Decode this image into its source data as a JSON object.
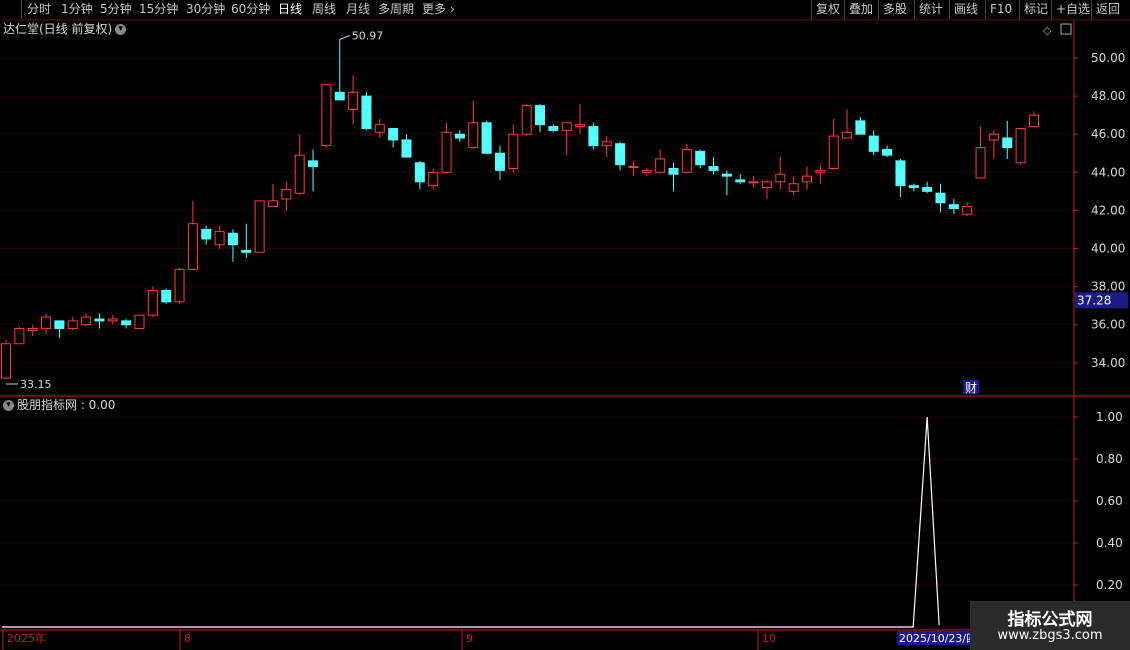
{
  "toolbar": {
    "periods": [
      "分时",
      "1分钟",
      "5分钟",
      "15分钟",
      "30分钟",
      "60分钟",
      "日线",
      "周线",
      "月线",
      "多周期",
      "更多"
    ],
    "active_period": "日线",
    "tools": [
      "复权",
      "叠加",
      "多股",
      "统计",
      "画线",
      "F10",
      "标记",
      "+自选",
      "返回"
    ]
  },
  "chart": {
    "title": "达仁堂(日线 前复权)",
    "max_label": "50.97",
    "min_label": "33.15",
    "current_price": "37.28",
    "finance_marker": "财",
    "up_color": "#ff3b3b",
    "down_color": "#54ffff",
    "axis_color": "#c02020"
  },
  "indicator": {
    "title": "股朋指标网 : 0.00",
    "line_color": "#ffffff"
  },
  "xaxis": {
    "labels": [
      "2025年",
      "8",
      "9",
      "10"
    ],
    "cursor_date": "2025/10/23/四"
  },
  "watermark": {
    "title": "指标公式网",
    "url": "www.zbgs3.com"
  },
  "chart_data": {
    "type": "candlestick",
    "price_axis_ticks": [
      34.0,
      36.0,
      38.0,
      40.0,
      42.0,
      44.0,
      46.0,
      48.0,
      50.0
    ],
    "price_ylim": [
      32.5,
      51.5
    ],
    "indicator_axis_ticks": [
      0.2,
      0.4,
      0.6,
      0.8,
      1.0
    ],
    "indicator_ylim": [
      0,
      1.1
    ],
    "candles": [
      [
        33.2,
        35.2,
        33.15,
        35.0
      ],
      [
        35.0,
        35.9,
        35.0,
        35.8
      ],
      [
        35.7,
        36.0,
        35.4,
        35.8
      ],
      [
        35.8,
        36.6,
        35.5,
        36.4
      ],
      [
        36.2,
        36.2,
        35.3,
        35.8
      ],
      [
        35.8,
        36.4,
        35.7,
        36.2
      ],
      [
        36.0,
        36.6,
        35.9,
        36.4
      ],
      [
        36.3,
        36.6,
        35.8,
        36.2
      ],
      [
        36.2,
        36.5,
        36.0,
        36.3
      ],
      [
        36.2,
        36.3,
        35.8,
        36.0
      ],
      [
        35.8,
        36.5,
        35.8,
        36.5
      ],
      [
        36.5,
        38.0,
        36.4,
        37.8
      ],
      [
        37.8,
        37.9,
        37.1,
        37.2
      ],
      [
        37.2,
        39.0,
        37.1,
        38.9
      ],
      [
        38.9,
        42.5,
        38.9,
        41.3
      ],
      [
        41.0,
        41.2,
        40.2,
        40.5
      ],
      [
        40.2,
        41.2,
        40.0,
        40.9
      ],
      [
        40.8,
        41.0,
        39.3,
        40.2
      ],
      [
        39.9,
        41.3,
        39.5,
        39.8
      ],
      [
        39.8,
        42.4,
        39.8,
        42.5
      ],
      [
        42.2,
        43.4,
        42.2,
        42.5
      ],
      [
        42.6,
        43.5,
        42.0,
        43.1
      ],
      [
        42.9,
        46.0,
        42.8,
        44.9
      ],
      [
        44.6,
        45.2,
        43.0,
        44.3
      ],
      [
        45.4,
        47.8,
        45.3,
        48.6
      ],
      [
        48.2,
        50.97,
        47.8,
        47.8
      ],
      [
        47.3,
        49.1,
        46.5,
        48.2
      ],
      [
        48.0,
        48.2,
        46.2,
        46.3
      ],
      [
        46.1,
        46.8,
        45.8,
        46.5
      ],
      [
        46.3,
        46.3,
        45.3,
        45.7
      ],
      [
        45.7,
        46.0,
        44.8,
        44.8
      ],
      [
        44.5,
        44.6,
        43.1,
        43.5
      ],
      [
        43.3,
        44.2,
        43.1,
        44.0
      ],
      [
        44.0,
        46.6,
        44.0,
        46.1
      ],
      [
        46.0,
        46.2,
        45.6,
        45.8
      ],
      [
        45.3,
        47.8,
        45.2,
        46.6
      ],
      [
        46.6,
        46.7,
        45.0,
        45.0
      ],
      [
        45.0,
        45.4,
        43.6,
        44.1
      ],
      [
        44.2,
        46.5,
        44.0,
        46.0
      ],
      [
        46.0,
        47.6,
        45.9,
        47.5
      ],
      [
        47.5,
        47.6,
        46.1,
        46.5
      ],
      [
        46.4,
        46.5,
        46.1,
        46.2
      ],
      [
        46.2,
        46.5,
        44.9,
        46.6
      ],
      [
        46.4,
        47.6,
        46.0,
        46.5
      ],
      [
        46.4,
        46.6,
        45.2,
        45.4
      ],
      [
        45.4,
        45.9,
        44.8,
        45.6
      ],
      [
        45.5,
        45.6,
        44.1,
        44.4
      ],
      [
        44.3,
        44.6,
        43.8,
        44.3
      ],
      [
        44.0,
        44.2,
        43.8,
        44.1
      ],
      [
        44.0,
        45.2,
        43.9,
        44.7
      ],
      [
        44.2,
        44.5,
        43.0,
        43.9
      ],
      [
        44.0,
        45.5,
        44.0,
        45.2
      ],
      [
        45.1,
        45.2,
        44.2,
        44.4
      ],
      [
        44.3,
        44.8,
        43.9,
        44.1
      ],
      [
        43.9,
        44.1,
        42.8,
        43.8
      ],
      [
        43.6,
        43.9,
        43.4,
        43.5
      ],
      [
        43.5,
        43.8,
        43.2,
        43.5
      ],
      [
        43.2,
        43.6,
        42.6,
        43.5
      ],
      [
        43.5,
        44.8,
        43.1,
        43.9
      ],
      [
        43.0,
        43.8,
        42.8,
        43.4
      ],
      [
        43.5,
        44.3,
        43.1,
        43.8
      ],
      [
        44.0,
        44.4,
        43.4,
        44.1
      ],
      [
        44.2,
        46.8,
        44.1,
        45.9
      ],
      [
        45.8,
        47.3,
        45.8,
        46.1
      ],
      [
        46.7,
        46.9,
        46.0,
        46.0
      ],
      [
        45.9,
        46.2,
        44.9,
        45.1
      ],
      [
        45.2,
        45.4,
        44.8,
        44.9
      ],
      [
        44.6,
        44.7,
        42.7,
        43.3
      ],
      [
        43.3,
        43.4,
        43.0,
        43.2
      ],
      [
        43.2,
        43.5,
        42.9,
        43.0
      ],
      [
        42.9,
        43.4,
        41.9,
        42.4
      ],
      [
        42.3,
        42.6,
        41.8,
        42.1
      ],
      [
        41.8,
        42.4,
        41.7,
        42.2
      ],
      [
        43.7,
        46.4,
        43.7,
        45.3
      ],
      [
        45.7,
        46.2,
        44.7,
        46.0
      ],
      [
        45.8,
        46.7,
        44.7,
        45.3
      ],
      [
        44.5,
        46.3,
        44.4,
        46.3
      ],
      [
        46.4,
        47.2,
        46.4,
        47.0
      ]
    ],
    "indicator_series": {
      "name": "股朋指标网",
      "spike_index": 69,
      "spike_value": 1.0,
      "baseline": 0.0,
      "last_value": 0.0
    }
  }
}
